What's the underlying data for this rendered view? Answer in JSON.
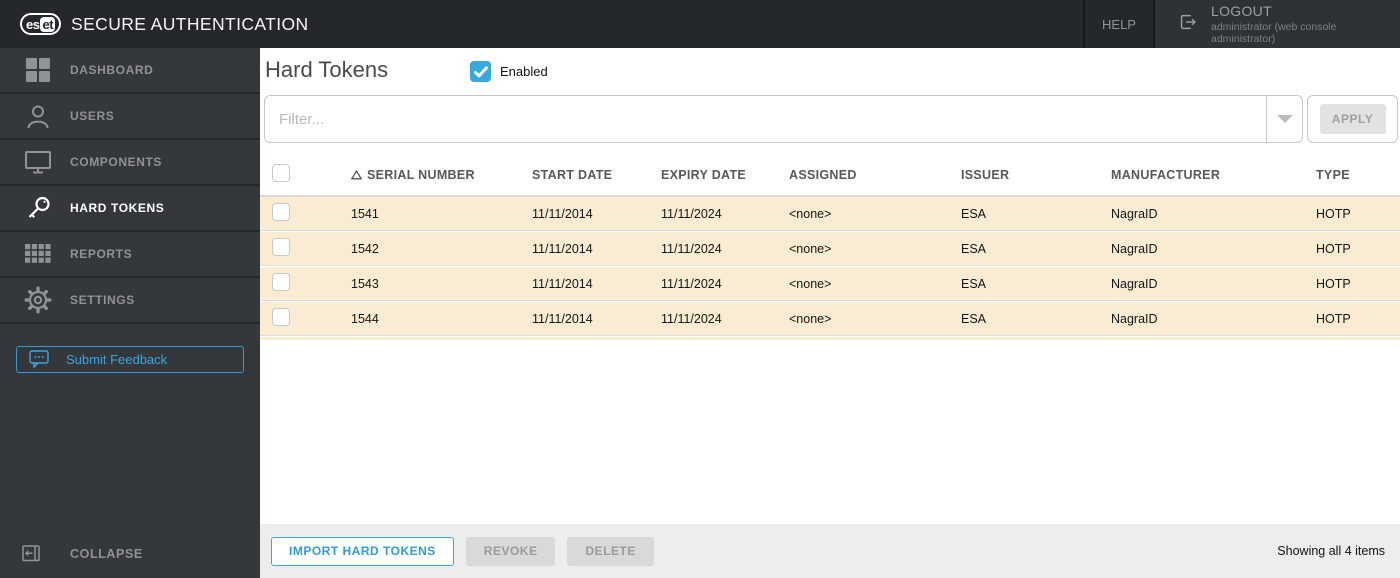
{
  "colors": {
    "accent": "#36a9e1",
    "row_background": "#faecd2",
    "topbar": "#24272c",
    "sidebar": "#34373c"
  },
  "topbar": {
    "logo": {
      "left": "es",
      "right": "et"
    },
    "brand": "SECURE AUTHENTICATION",
    "help": "HELP",
    "logout": {
      "label": "LOGOUT",
      "subtitle": "administrator (web console administrator)"
    }
  },
  "sidebar": {
    "items": [
      {
        "label": "DASHBOARD",
        "active": false
      },
      {
        "label": "USERS",
        "active": false
      },
      {
        "label": "COMPONENTS",
        "active": false
      },
      {
        "label": "HARD TOKENS",
        "active": true
      },
      {
        "label": "REPORTS",
        "active": false
      },
      {
        "label": "SETTINGS",
        "active": false
      }
    ],
    "feedback": "Submit Feedback",
    "collapse": "COLLAPSE"
  },
  "main": {
    "title": "Hard Tokens",
    "enabled": {
      "label": "Enabled",
      "checked": true
    },
    "filter": {
      "placeholder": "Filter...",
      "value": ""
    },
    "apply": "APPLY"
  },
  "table": {
    "columns": [
      "SERIAL NUMBER",
      "START DATE",
      "EXPIRY DATE",
      "ASSIGNED",
      "ISSUER",
      "MANUFACTURER",
      "TYPE"
    ],
    "sorted_column": "SERIAL NUMBER",
    "sort_direction": "ascending",
    "rows": [
      {
        "serial": "1541",
        "start": "11/11/2014",
        "expiry": "11/11/2024",
        "assigned": "<none>",
        "issuer": "ESA",
        "manufacturer": "NagraID",
        "type": "HOTP"
      },
      {
        "serial": "1542",
        "start": "11/11/2014",
        "expiry": "11/11/2024",
        "assigned": "<none>",
        "issuer": "ESA",
        "manufacturer": "NagraID",
        "type": "HOTP"
      },
      {
        "serial": "1543",
        "start": "11/11/2014",
        "expiry": "11/11/2024",
        "assigned": "<none>",
        "issuer": "ESA",
        "manufacturer": "NagraID",
        "type": "HOTP"
      },
      {
        "serial": "1544",
        "start": "11/11/2014",
        "expiry": "11/11/2024",
        "assigned": "<none>",
        "issuer": "ESA",
        "manufacturer": "NagraID",
        "type": "HOTP"
      }
    ]
  },
  "footer": {
    "import_label": "IMPORT HARD TOKENS",
    "revoke_label": "REVOKE",
    "delete_label": "DELETE",
    "status": "Showing all 4 items"
  }
}
